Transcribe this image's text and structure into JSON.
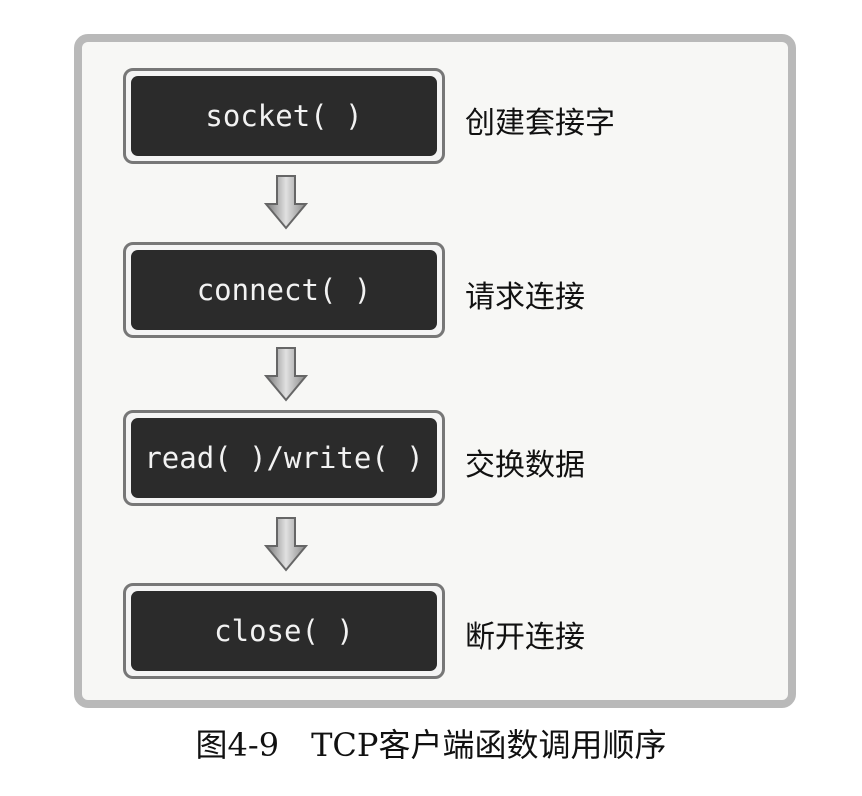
{
  "steps": [
    {
      "func": "socket( )",
      "desc": "创建套接字"
    },
    {
      "func": "connect( )",
      "desc": "请求连接"
    },
    {
      "func": "read( )/write( )",
      "desc": "交换数据"
    },
    {
      "func": "close( )",
      "desc": "断开连接"
    }
  ],
  "caption": "图4-9　TCP客户端函数调用顺序",
  "colors": {
    "box": "#2b2b2b",
    "frame": "#b9b9b9",
    "arrow": "#999999"
  }
}
